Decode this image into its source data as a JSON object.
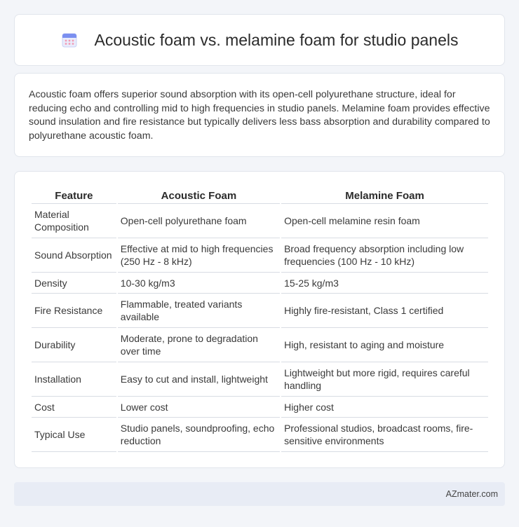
{
  "header": {
    "title": "Acoustic foam vs. melamine foam for studio panels",
    "icon": "calendar-icon"
  },
  "summary": "Acoustic foam offers superior sound absorption with its open-cell polyurethane structure, ideal for reducing echo and controlling mid to high frequencies in studio panels. Melamine foam provides effective sound insulation and fire resistance but typically delivers less bass absorption and durability compared to polyurethane acoustic foam.",
  "table": {
    "headers": [
      "Feature",
      "Acoustic Foam",
      "Melamine Foam"
    ],
    "rows": [
      [
        "Material Composition",
        "Open-cell polyurethane foam",
        "Open-cell melamine resin foam"
      ],
      [
        "Sound Absorption",
        "Effective at mid to high frequencies (250 Hz - 8 kHz)",
        "Broad frequency absorption including low frequencies (100 Hz - 10 kHz)"
      ],
      [
        "Density",
        "10-30 kg/m3",
        "15-25 kg/m3"
      ],
      [
        "Fire Resistance",
        "Flammable, treated variants available",
        "Highly fire-resistant, Class 1 certified"
      ],
      [
        "Durability",
        "Moderate, prone to degradation over time",
        "High, resistant to aging and moisture"
      ],
      [
        "Installation",
        "Easy to cut and install, lightweight",
        "Lightweight but more rigid, requires careful handling"
      ],
      [
        "Cost",
        "Lower cost",
        "Higher cost"
      ],
      [
        "Typical Use",
        "Studio panels, soundproofing, echo reduction",
        "Professional studios, broadcast rooms, fire-sensitive environments"
      ]
    ]
  },
  "footer": {
    "brand": "AZmater.com"
  },
  "colors": {
    "background": "#f3f5f9",
    "card": "#ffffff",
    "footer": "#e8ecf5",
    "icon_top": "#7b8ff0",
    "icon_body": "#e9ecfb",
    "icon_dots": "#f29ab5"
  }
}
